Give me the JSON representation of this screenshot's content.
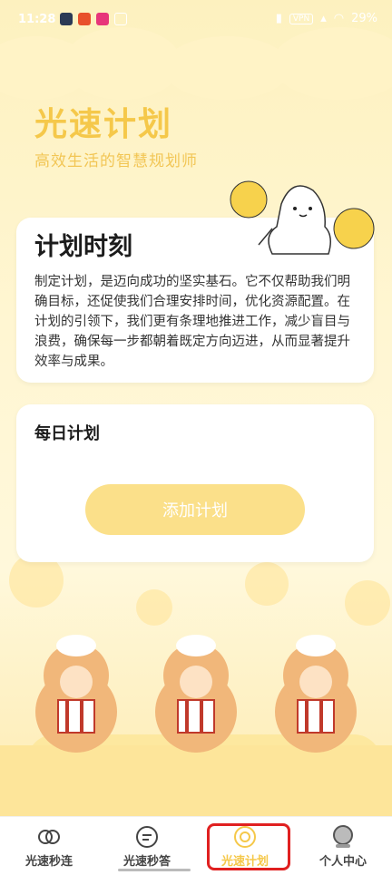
{
  "status_bar": {
    "time": "11:28",
    "battery": "29%",
    "vpn": "VPN"
  },
  "header": {
    "title": "光速计划",
    "subtitle": "高效生活的智慧规划师"
  },
  "intro_card": {
    "title": "计划时刻",
    "body": "制定计划，是迈向成功的坚实基石。它不仅帮助我们明确目标，还促使我们合理安排时间，优化资源配置。在计划的引领下，我们更有条理地推进工作，减少盲目与浪费，确保每一步都朝着既定方向迈进，从而显著提升效率与成果。"
  },
  "daily_card": {
    "title": "每日计划",
    "add_button": "添加计划"
  },
  "nav": {
    "items": [
      {
        "label": "光速秒连",
        "icon": "link-rings-icon"
      },
      {
        "label": "光速秒答",
        "icon": "chat-bubble-icon"
      },
      {
        "label": "光速计划",
        "icon": "plan-icon",
        "active": true
      },
      {
        "label": "个人中心",
        "icon": "user-icon"
      }
    ]
  },
  "colors": {
    "accent": "#f5c84a",
    "button": "#fbe08a",
    "highlight": "#e02020"
  }
}
